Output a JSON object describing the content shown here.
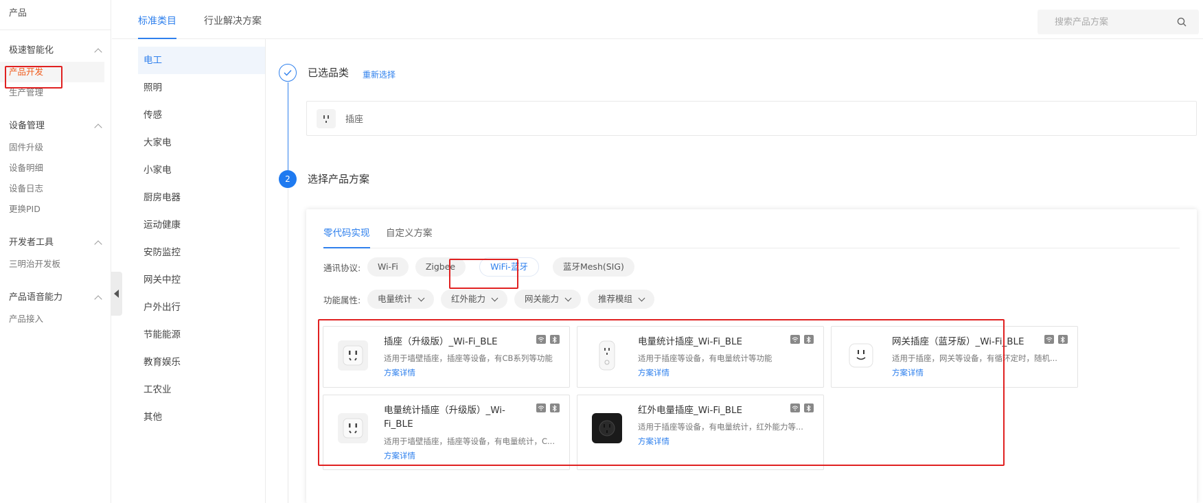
{
  "sidebar": {
    "top_label": "产品",
    "groups": [
      {
        "title": "极速智能化",
        "items": [
          "产品开发",
          "生产管理"
        ]
      },
      {
        "title": "设备管理",
        "items": [
          "固件升级",
          "设备明细",
          "设备日志",
          "更换PID"
        ]
      },
      {
        "title": "开发者工具",
        "items": [
          "三明治开发板"
        ]
      },
      {
        "title": "产品语音能力",
        "items": [
          "产品接入"
        ]
      }
    ],
    "active_item": "产品开发"
  },
  "top_tabs": [
    "标准类目",
    "行业解决方案"
  ],
  "search": {
    "placeholder": "搜索产品方案"
  },
  "categories": [
    "电工",
    "照明",
    "传感",
    "大家电",
    "小家电",
    "厨房电器",
    "运动健康",
    "安防监控",
    "网关中控",
    "户外出行",
    "节能能源",
    "教育娱乐",
    "工农业",
    "其他"
  ],
  "step1": {
    "title": "已选品类",
    "reselect": "重新选择",
    "selected": "插座"
  },
  "step2": {
    "number": "2",
    "title": "选择产品方案"
  },
  "scheme_tabs": [
    "零代码实现",
    "自定义方案"
  ],
  "protocol": {
    "label": "通讯协议:",
    "options": [
      "Wi-Fi",
      "Zigbee",
      "WiFi-蓝牙",
      "蓝牙Mesh(SIG)"
    ],
    "selected": "WiFi-蓝牙"
  },
  "features": {
    "label": "功能属性:",
    "options": [
      "电量统计",
      "红外能力",
      "网关能力",
      "推荐模组"
    ]
  },
  "cards": [
    {
      "title": "插座（升级版）_Wi-Fi_BLE",
      "desc": "适用于墙壁插座，插座等设备，有CB系列等功能",
      "link": "方案详情",
      "icon": "socket-white-icon"
    },
    {
      "title": "电量统计插座_Wi-Fi_BLE",
      "desc": "适用于插座等设备，有电量统计等功能",
      "link": "方案详情",
      "icon": "plug-white-icon"
    },
    {
      "title": "网关插座（蓝牙版）_Wi-Fi_BLE",
      "desc": "适用于插座，网关等设备，有循环定时，随机...",
      "link": "方案详情",
      "icon": "socket-round-icon"
    },
    {
      "title": "电量统计插座（升级版）_Wi-Fi_BLE",
      "desc": "适用于墙壁插座，插座等设备，有电量统计，C...",
      "link": "方案详情",
      "icon": "socket-white-icon"
    },
    {
      "title": "红外电量插座_Wi-Fi_BLE",
      "desc": "适用于插座等设备，有电量统计，红外能力等...",
      "link": "方案详情",
      "icon": "socket-black-icon"
    }
  ],
  "colors": {
    "accent": "#2f80ed",
    "active_orange": "#f05a1a",
    "highlight_red": "#e02020"
  }
}
